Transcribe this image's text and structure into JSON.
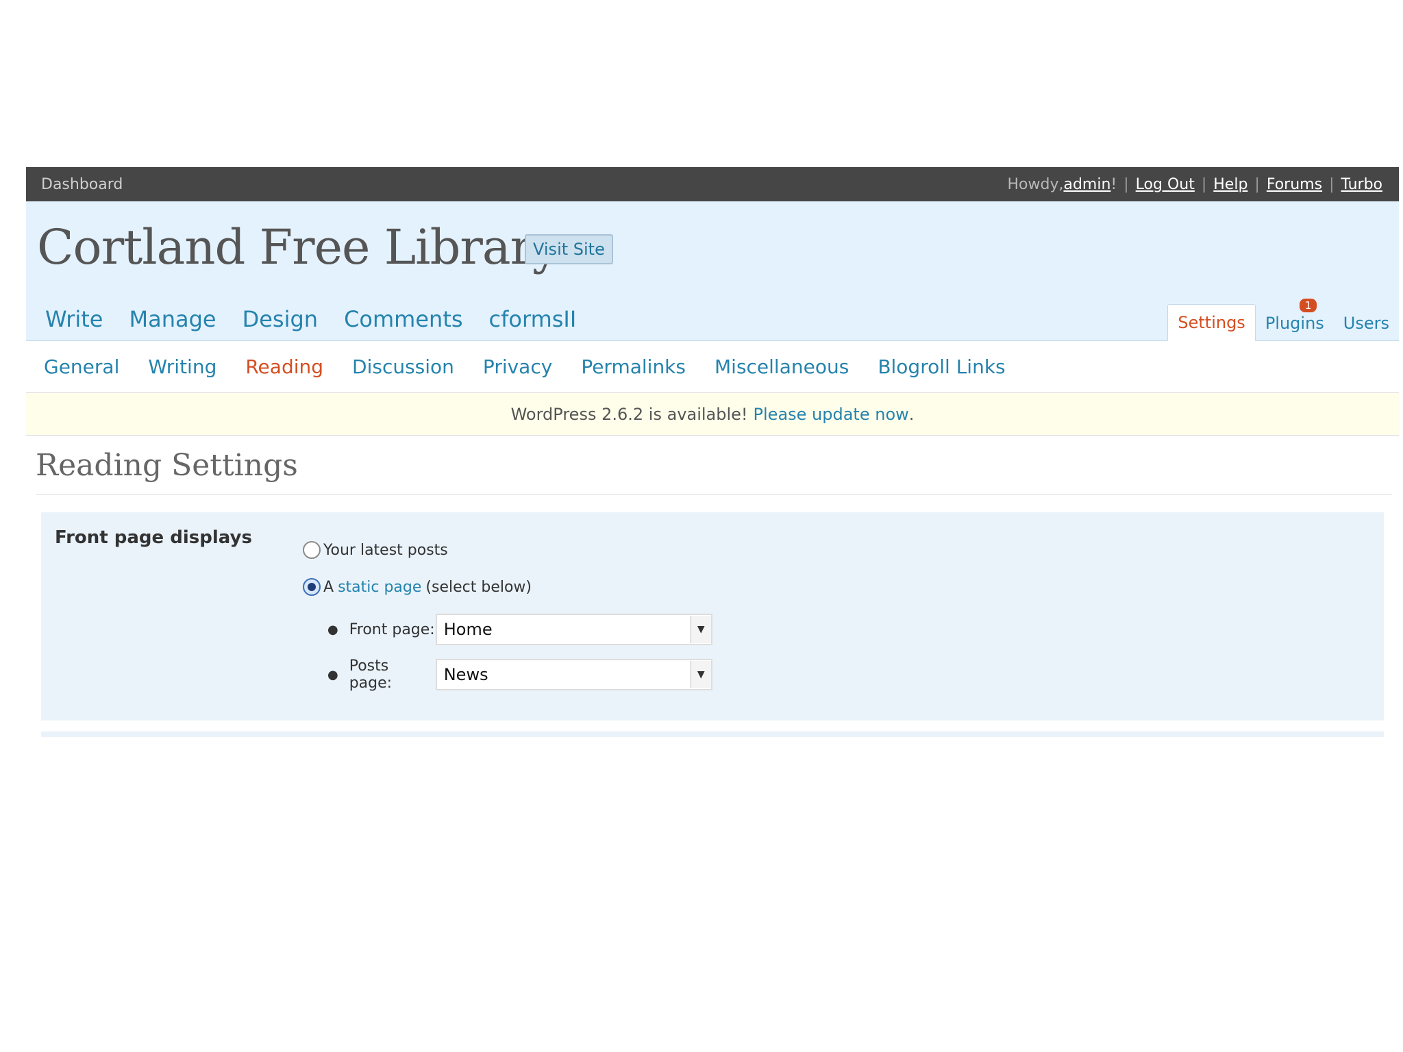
{
  "topbar": {
    "dashboard": "Dashboard",
    "howdy_prefix": "Howdy, ",
    "user": "admin",
    "howdy_suffix": "!",
    "links": [
      "Log Out",
      "Help",
      "Forums",
      "Turbo"
    ]
  },
  "header": {
    "site_title": "Cortland Free Library",
    "visit_site": "Visit Site"
  },
  "main_menu": [
    "Write",
    "Manage",
    "Design",
    "Comments",
    "cformsII"
  ],
  "side_menu": {
    "settings": "Settings",
    "plugins": "Plugins",
    "plugins_badge": "1",
    "users": "Users"
  },
  "submenu": [
    "General",
    "Writing",
    "Reading",
    "Discussion",
    "Privacy",
    "Permalinks",
    "Miscellaneous",
    "Blogroll Links"
  ],
  "update_nag": {
    "text": "WordPress 2.6.2 is available!",
    "link": "Please update now",
    "period": "."
  },
  "page": {
    "title": "Reading Settings",
    "row_label": "Front page displays",
    "radio_latest": "Your latest posts",
    "radio_static_prefix": "A",
    "radio_static_link": "static page",
    "radio_static_suffix": "(select below)",
    "front_page_label": "Front page:",
    "front_page_value": "Home",
    "posts_page_label": "Posts page:",
    "posts_page_value": "News"
  },
  "colors": {
    "accent": "#2583ad",
    "current": "#d54e21",
    "topbar": "#464646",
    "header_bg": "#e4f2fd"
  }
}
